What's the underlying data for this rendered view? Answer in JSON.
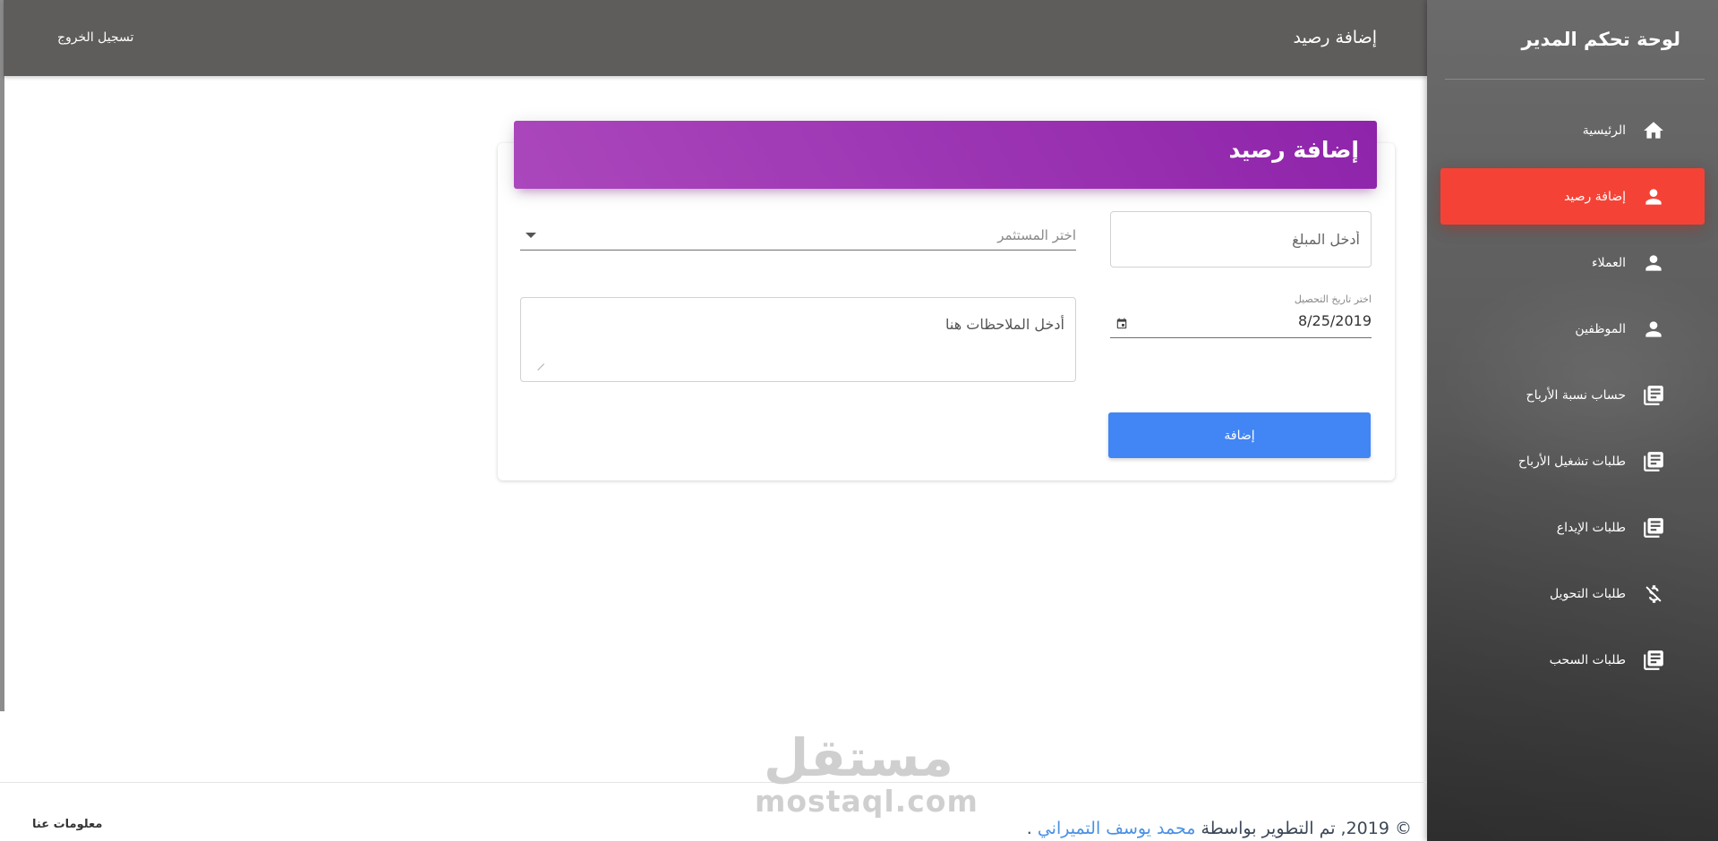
{
  "sidebar": {
    "brand_title": "لوحة تحكم المدير",
    "items": [
      {
        "label": "الرئيسية",
        "icon": "home-icon",
        "active": false
      },
      {
        "label": "إضافة رصيد",
        "icon": "person-icon",
        "active": true
      },
      {
        "label": "العملاء",
        "icon": "person-icon",
        "active": false
      },
      {
        "label": "الموظفين",
        "icon": "person-icon",
        "active": false
      },
      {
        "label": "حساب نسبة الأرباح",
        "icon": "library-books-icon",
        "active": false
      },
      {
        "label": "طلبات تشغيل الأرباح",
        "icon": "library-books-icon",
        "active": false
      },
      {
        "label": "طلبات الإيداع",
        "icon": "library-books-icon",
        "active": false
      },
      {
        "label": "طلبات التحويل",
        "icon": "money-off-icon",
        "active": false
      },
      {
        "label": "طلبات السحب",
        "icon": "library-books-icon",
        "active": false
      }
    ],
    "active_color": "#f44336"
  },
  "topbar": {
    "title": "إضافة رصيد",
    "logout_label": "تسجيل الخروج"
  },
  "card": {
    "title": "إضافة رصيد",
    "header_color": "#9c27b0",
    "amount_placeholder": "أدخل المبلغ",
    "recipient_placeholder": "اختر المستثمر",
    "date_label": "اختر تاريخ التحصيل",
    "date_value": "8/25/2019",
    "notes_placeholder": "أدخل الملاحظات هنا",
    "submit_label": "إضافة",
    "submit_color": "#4285f4"
  },
  "footer": {
    "about_label": "معلومات عنا",
    "copyright_prefix": "© 2019, تم التطوير بواسطة",
    "author_name": "محمد يوسف التميراني",
    "copyright_suffix": "."
  },
  "watermark": {
    "arabic": "مستقل",
    "latin": "mostaql.com"
  }
}
